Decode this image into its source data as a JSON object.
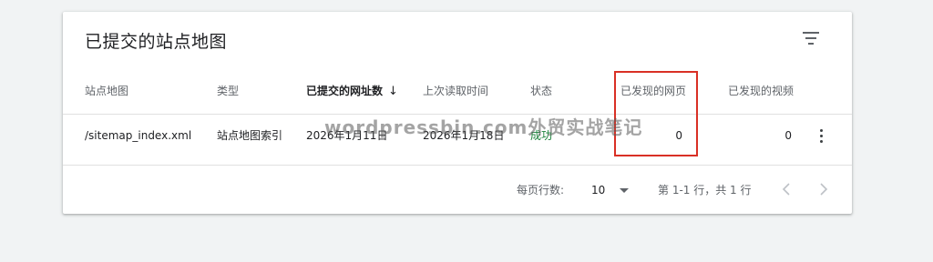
{
  "card": {
    "title": "已提交的站点地图",
    "filter_icon": "filter-list-icon"
  },
  "table": {
    "columns": [
      {
        "label": "站点地图"
      },
      {
        "label": "类型"
      },
      {
        "label": "已提交的网址数",
        "sorted": "desc"
      },
      {
        "label": "上次读取时间"
      },
      {
        "label": "状态"
      },
      {
        "label": "已发现的网页"
      },
      {
        "label": "已发现的视频"
      }
    ],
    "rows": [
      {
        "sitemap": "/sitemap_index.xml",
        "type": "站点地图索引",
        "submitted": "2026年1月11日",
        "last_read": "2026年1月18日",
        "status": "成功",
        "pages": "0",
        "videos": "0"
      }
    ]
  },
  "footer": {
    "rows_per_page_label": "每页行数:",
    "rows_per_page_value": "10",
    "range_text": "第 1-1 行，共 1 行"
  },
  "watermark": "wordpressbin.com外贸实战笔记",
  "colors": {
    "status_success": "#188038",
    "highlight": "#d93025",
    "background": "#f1f3f4"
  },
  "icons": {
    "sort": "arrow-down-icon",
    "more": "more-vert-icon",
    "prev": "chevron-left-icon",
    "next": "chevron-right-icon",
    "dropdown": "caret-down-icon"
  }
}
